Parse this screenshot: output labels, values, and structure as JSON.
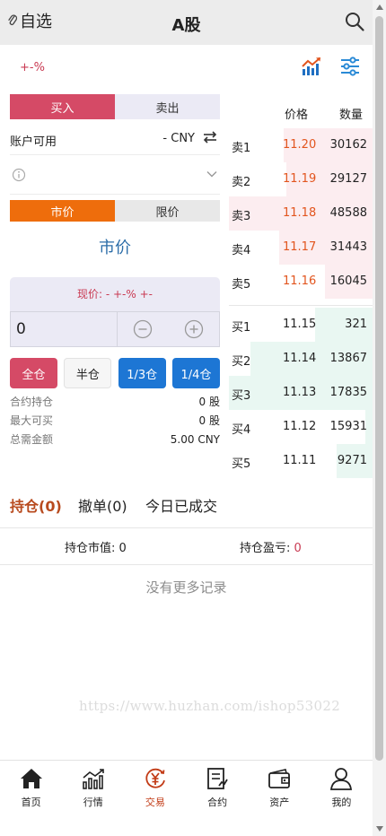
{
  "header": {
    "watchlist_label": "自选",
    "title": "A股"
  },
  "change_text": "+-%",
  "trade_tabs": {
    "buy": "买入",
    "sell": "卖出"
  },
  "account": {
    "label": "账户可用",
    "value": "- CNY"
  },
  "order_type_tabs": {
    "market": "市价",
    "limit": "限价"
  },
  "market_label": "市价",
  "current_price": "现价: - +-% +-",
  "quantity": "0",
  "position_buttons": {
    "full": "全仓",
    "half": "半仓",
    "third": "1/3仓",
    "quarter": "1/4仓"
  },
  "summary": [
    {
      "label": "合约持仓",
      "value": "0 股"
    },
    {
      "label": "最大可买",
      "value": "0 股"
    },
    {
      "label": "总需金额",
      "value": "5.00 CNY"
    }
  ],
  "order_book": {
    "header": {
      "price": "价格",
      "qty": "数量"
    },
    "asks": [
      {
        "label": "卖1",
        "price": "11.20",
        "qty": "30162",
        "depth": 0.62
      },
      {
        "label": "卖2",
        "price": "11.19",
        "qty": "29127",
        "depth": 0.6
      },
      {
        "label": "卖3",
        "price": "11.18",
        "qty": "48588",
        "depth": 1.0
      },
      {
        "label": "卖4",
        "price": "11.17",
        "qty": "31443",
        "depth": 0.65
      },
      {
        "label": "卖5",
        "price": "11.16",
        "qty": "16045",
        "depth": 0.33
      }
    ],
    "bids": [
      {
        "label": "买1",
        "price": "11.15",
        "qty": "321",
        "depth": 0.4
      },
      {
        "label": "买2",
        "price": "11.14",
        "qty": "13867",
        "depth": 0.85
      },
      {
        "label": "买3",
        "price": "11.13",
        "qty": "17835",
        "depth": 1.0
      },
      {
        "label": "买4",
        "price": "11.12",
        "qty": "15931",
        "depth": 0.05
      },
      {
        "label": "买5",
        "price": "11.11",
        "qty": "9271",
        "depth": 0.25
      }
    ]
  },
  "records_tabs": {
    "holdings": "持仓(0)",
    "cancel": "撤单(0)",
    "today": "今日已成交"
  },
  "holdings_summary": {
    "market_value_label": "持仓市值:",
    "market_value": "0",
    "pnl_label": "持仓盈亏:",
    "pnl": "0"
  },
  "no_more": "没有更多记录",
  "watermark": "https://www.huzhan.com/ishop53022",
  "nav": [
    {
      "label": "首页",
      "icon": "home-icon"
    },
    {
      "label": "行情",
      "icon": "market-chart-icon"
    },
    {
      "label": "交易",
      "icon": "trade-yuan-icon",
      "active": true
    },
    {
      "label": "合约",
      "icon": "contract-icon"
    },
    {
      "label": "资产",
      "icon": "wallet-icon"
    },
    {
      "label": "我的",
      "icon": "user-icon"
    }
  ],
  "colors": {
    "buy": "#d54a66",
    "market_tab": "#ee6d0c",
    "blue_button": "#1d76d4",
    "ask_price": "#e2551e",
    "active_nav": "#c23b16"
  }
}
